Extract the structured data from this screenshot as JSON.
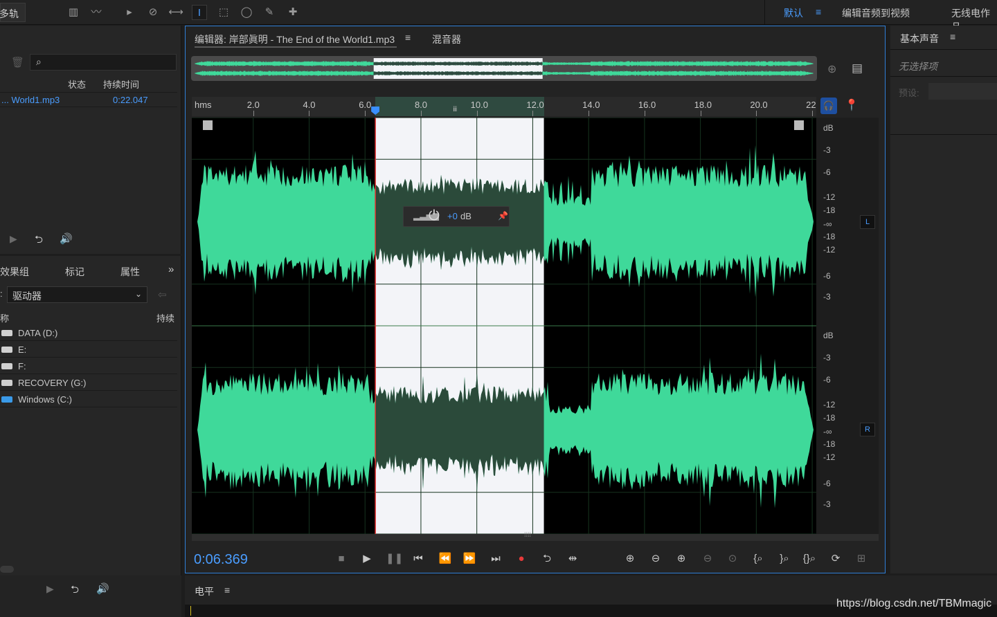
{
  "toolbar": {
    "mode_label": "多轨",
    "workspace_default": "默认",
    "workspace_edit_video": "编辑音频到视频",
    "workspace_radio": "无线电作品"
  },
  "files_panel": {
    "search_placeholder": "",
    "col_status": "状态",
    "col_duration": "持续时间",
    "file_name": "... World1.mp3",
    "file_duration": "0:22.047"
  },
  "lower_panel": {
    "tab_effects": "效果组",
    "tab_markers": "标记",
    "tab_properties": "属性",
    "dropdown_value": "驱动器",
    "col_name": "称",
    "col_duration": "持续",
    "drives": [
      {
        "label": "DATA (D:)",
        "icon": "drive-icon"
      },
      {
        "label": "E:",
        "icon": "drive-icon"
      },
      {
        "label": "F:",
        "icon": "drive-icon"
      },
      {
        "label": "RECOVERY (G:)",
        "icon": "drive-icon"
      },
      {
        "label": "Windows (C:)",
        "icon": "windows-drive-icon"
      }
    ]
  },
  "editor": {
    "tab_title": "编辑器: 岸部眞明 - The End of the World1.mp3",
    "tab_mixer": "混音器",
    "timecode": "0:06.369",
    "hud_value": "+0",
    "hud_unit": "dB",
    "ruler_unit": "hms",
    "ruler_ticks": [
      "2.0",
      "4.0",
      "6.0",
      "8.0",
      "10.0",
      "12.0",
      "14.0",
      "16.0",
      "18.0",
      "20.0",
      "22"
    ],
    "channel_left": "L",
    "channel_right": "R",
    "db_scale": [
      "dB",
      "-3",
      "-6",
      "-12",
      "-18",
      "-∞",
      "-18",
      "-12",
      "-6",
      "-3"
    ],
    "selection": {
      "start_sec": 6.37,
      "end_sec": 12.4,
      "total_sec": 22.047
    },
    "accent_color": "#2f7fd8",
    "wave_color": "#3fd99a"
  },
  "right_panel": {
    "title": "基本声音",
    "no_selection": "无选择项",
    "preset_label": "预设:"
  },
  "bottom_panel": {
    "title": "电平"
  },
  "watermark": "https://blog.csdn.net/TBMmagic"
}
